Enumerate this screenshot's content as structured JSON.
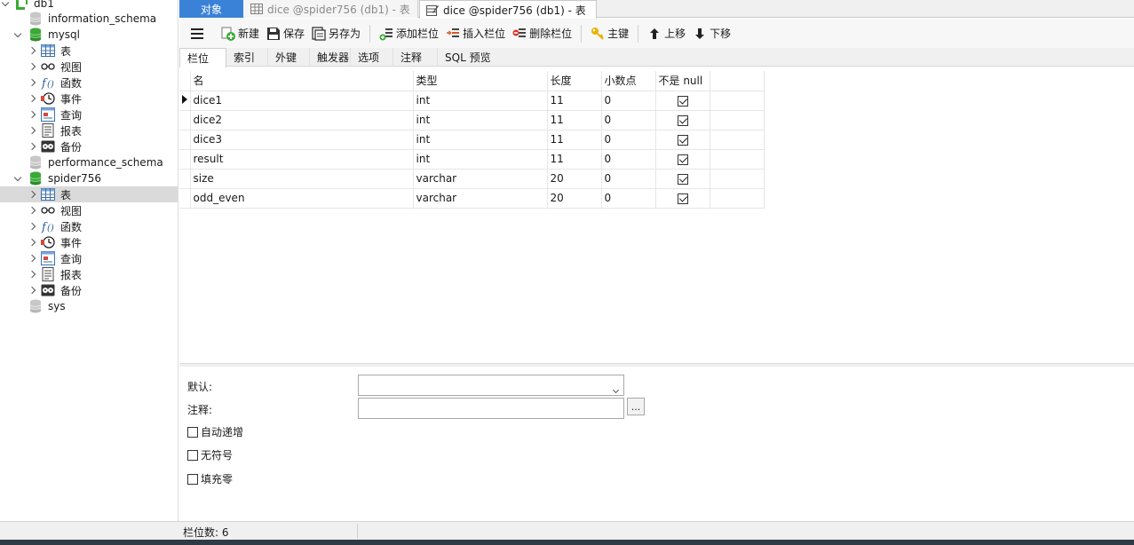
{
  "sidebar": {
    "connection": {
      "label": "db1",
      "icon": "connection-icon"
    },
    "items": [
      {
        "label": "information_schema",
        "icon": "database-gray-icon"
      },
      {
        "label": "mysql",
        "icon": "database-green-icon",
        "expanded": true
      },
      {
        "label": "表",
        "icon": "table-icon"
      },
      {
        "label": "视图",
        "icon": "view-icon"
      },
      {
        "label": "函数",
        "icon": "function-icon"
      },
      {
        "label": "事件",
        "icon": "event-icon"
      },
      {
        "label": "查询",
        "icon": "query-icon"
      },
      {
        "label": "报表",
        "icon": "report-icon"
      },
      {
        "label": "备份",
        "icon": "backup-icon"
      },
      {
        "label": "performance_schema",
        "icon": "database-gray-icon"
      },
      {
        "label": "spider756",
        "icon": "database-green-icon",
        "expanded": true
      },
      {
        "label": "表",
        "icon": "table-icon",
        "selected": true
      },
      {
        "label": "视图",
        "icon": "view-icon"
      },
      {
        "label": "函数",
        "icon": "function-icon"
      },
      {
        "label": "事件",
        "icon": "event-icon"
      },
      {
        "label": "查询",
        "icon": "query-icon"
      },
      {
        "label": "报表",
        "icon": "report-icon"
      },
      {
        "label": "备份",
        "icon": "backup-icon"
      },
      {
        "label": "sys",
        "icon": "database-gray-icon"
      }
    ]
  },
  "tabs": {
    "objects": "对象",
    "tab2": "dice @spider756 (db1) - 表",
    "tab3": "dice @spider756 (db1) - 表"
  },
  "toolbar": {
    "new": "新建",
    "save": "保存",
    "save_as": "另存为",
    "add_field": "添加栏位",
    "insert_field": "插入栏位",
    "delete_field": "删除栏位",
    "primary_key": "主键",
    "move_up": "上移",
    "move_down": "下移"
  },
  "subtabs": [
    "栏位",
    "索引",
    "外键",
    "触发器",
    "选项",
    "注释",
    "SQL 预览"
  ],
  "grid": {
    "headers": [
      "名",
      "类型",
      "长度",
      "小数点",
      "不是 null"
    ],
    "rows": [
      {
        "name": "dice1",
        "type": "int",
        "length": "11",
        "decimals": "0",
        "not_null": true
      },
      {
        "name": "dice2",
        "type": "int",
        "length": "11",
        "decimals": "0",
        "not_null": true
      },
      {
        "name": "dice3",
        "type": "int",
        "length": "11",
        "decimals": "0",
        "not_null": true
      },
      {
        "name": "result",
        "type": "int",
        "length": "11",
        "decimals": "0",
        "not_null": true
      },
      {
        "name": "size",
        "type": "varchar",
        "length": "20",
        "decimals": "0",
        "not_null": true
      },
      {
        "name": "odd_even",
        "type": "varchar",
        "length": "20",
        "decimals": "0",
        "not_null": true
      }
    ]
  },
  "props": {
    "default_label": "默认:",
    "comment_label": "注释:",
    "comment_more": "...",
    "auto_increment": "自动递增",
    "unsigned": "无符号",
    "zerofill": "填充零"
  },
  "status": {
    "field_count": "栏位数: 6"
  },
  "colors": {
    "accent": "#3a82d8",
    "db_green": "#3aa935"
  }
}
